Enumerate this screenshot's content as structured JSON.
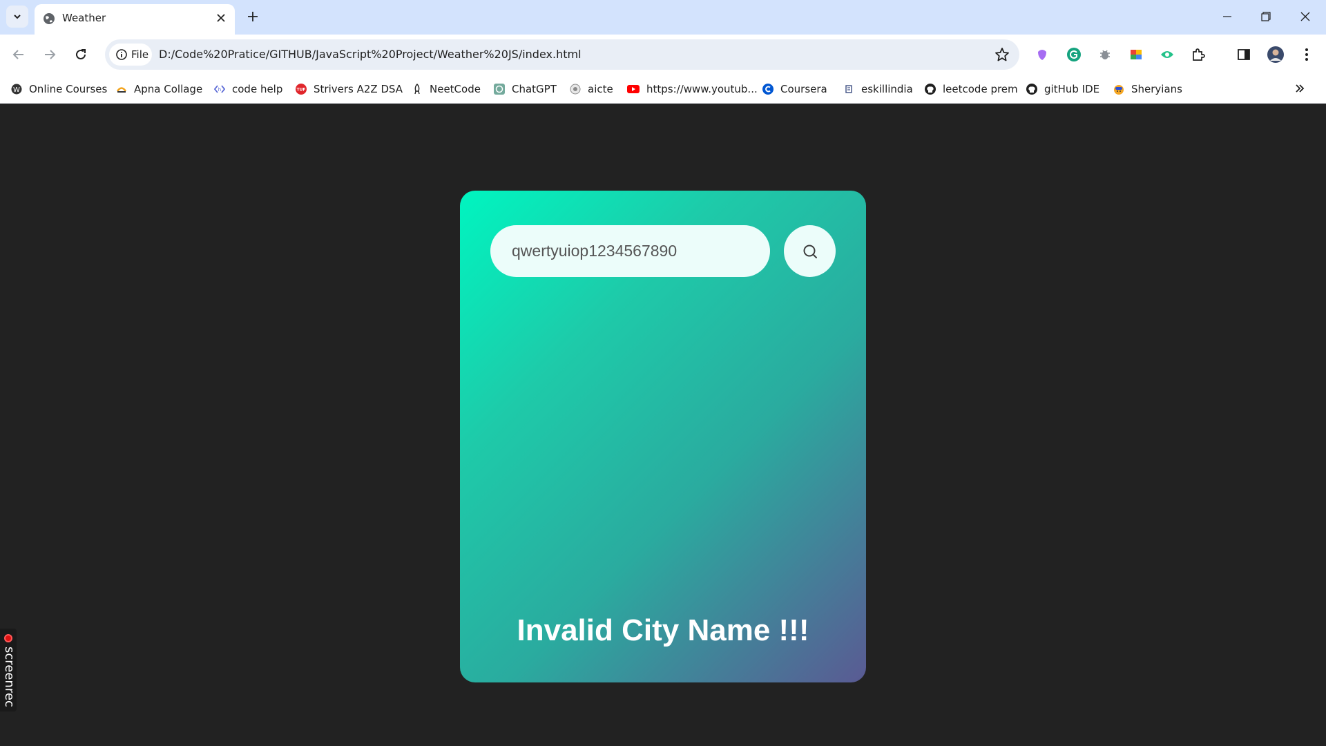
{
  "browser": {
    "tab": {
      "title": "Weather",
      "favicon": "globe-icon"
    },
    "address": {
      "chip_label": "File",
      "url": "D:/Code%20Pratice/GITHUB/JavaScript%20Project/Weather%20JS/index.html"
    },
    "bookmarks": [
      {
        "label": "Online Courses",
        "icon": "wordpress-icon",
        "color": "#333333"
      },
      {
        "label": "Apna Collage",
        "icon": "apna-icon",
        "color": "#f2a31b"
      },
      {
        "label": "code help",
        "icon": "codehelp-icon",
        "color": "#5b6ad6"
      },
      {
        "label": "Strivers A2Z DSA",
        "icon": "tuf-icon",
        "color": "#e0252b"
      },
      {
        "label": "NeetCode",
        "icon": "rocket-icon",
        "color": "#1f1f1f"
      },
      {
        "label": "ChatGPT",
        "icon": "chatgpt-icon",
        "color": "#74aa9c"
      },
      {
        "label": "aicte",
        "icon": "aicte-icon",
        "color": "#8a8a8a"
      },
      {
        "label": "https://www.youtub...",
        "icon": "youtube-icon",
        "color": "#ff0000"
      },
      {
        "label": "Coursera",
        "icon": "coursera-icon",
        "color": "#0056d2"
      },
      {
        "label": "eskillindia",
        "icon": "eskill-icon",
        "color": "#4a5a8a"
      },
      {
        "label": "leetcode prem",
        "icon": "github-icon",
        "color": "#1f1f1f"
      },
      {
        "label": "gitHub IDE",
        "icon": "github-icon",
        "color": "#1f1f1f"
      },
      {
        "label": "Sheryians",
        "icon": "sheryians-icon",
        "color": "#f5a623"
      }
    ]
  },
  "app": {
    "search": {
      "value": "qwertyuiop1234567890",
      "placeholder": ""
    },
    "error_message": "Invalid City Name !!!",
    "accent_start": "#00f5c0",
    "accent_end": "#5a5a93"
  },
  "overlay": {
    "label": "screenrec"
  }
}
